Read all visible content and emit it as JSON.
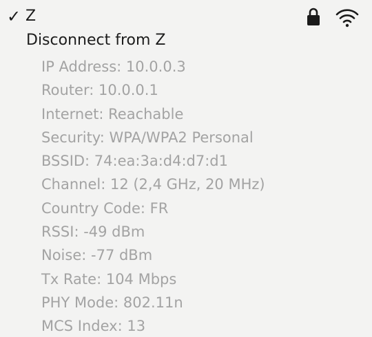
{
  "network": {
    "checkmark": "✓",
    "name": "Z",
    "secured": true,
    "lock_icon": "lock-icon",
    "signal_icon": "wifi-signal-icon",
    "signal_bars": 3,
    "signal_bars_total": 3
  },
  "disconnect_label": "Disconnect from Z",
  "details": [
    "IP Address: 10.0.0.3",
    "Router: 10.0.0.1",
    "Internet: Reachable",
    "Security: WPA/WPA2 Personal",
    "BSSID: 74:ea:3a:d4:d7:d1",
    "Channel: 12 (2,4 GHz, 20 MHz)",
    "Country Code: FR",
    "RSSI: -49 dBm",
    "Noise: -77 dBm",
    "Tx Rate: 104 Mbps",
    "PHY Mode: 802.11n",
    "MCS Index: 13"
  ],
  "colors": {
    "background": "#f3f3f2",
    "primary_text": "#1a1a1a",
    "secondary_text": "#a3a3a3"
  }
}
